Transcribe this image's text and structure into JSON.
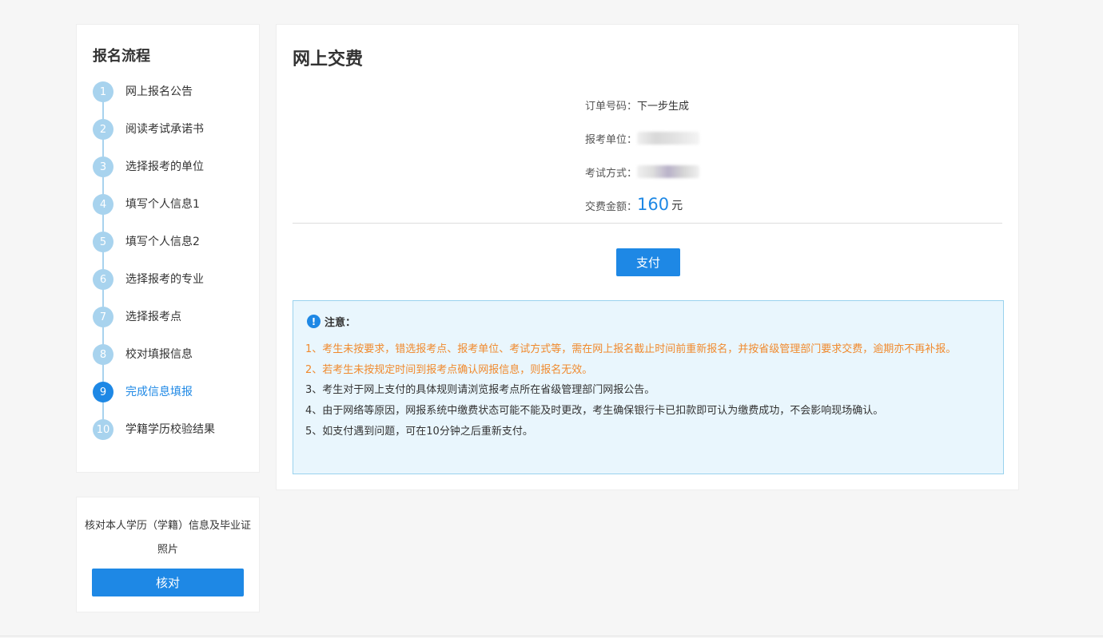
{
  "sidebar": {
    "title": "报名流程",
    "steps": [
      {
        "num": "1",
        "label": "网上报名公告"
      },
      {
        "num": "2",
        "label": "阅读考试承诺书"
      },
      {
        "num": "3",
        "label": "选择报考的单位"
      },
      {
        "num": "4",
        "label": "填写个人信息1"
      },
      {
        "num": "5",
        "label": "填写个人信息2"
      },
      {
        "num": "6",
        "label": "选择报考的专业"
      },
      {
        "num": "7",
        "label": "选择报考点"
      },
      {
        "num": "8",
        "label": "校对填报信息"
      },
      {
        "num": "9",
        "label": "完成信息填报"
      },
      {
        "num": "10",
        "label": "学籍学历校验结果"
      }
    ],
    "active_step": 9
  },
  "verify": {
    "text": "核对本人学历（学籍）信息及毕业证照片",
    "button": "核对"
  },
  "main": {
    "title": "网上交费",
    "order_label": "订单号码：",
    "order_value": "下一步生成",
    "unit_label": "报考单位：",
    "mode_label": "考试方式：",
    "amount_label": "交费金额：",
    "amount_value": "160",
    "amount_unit": "元",
    "pay_button": "支付",
    "notice_title": "注意：",
    "notice_items": [
      "1、考生未按要求，错选报考点、报考单位、考试方式等，需在网上报名截止时间前重新报名，并按省级管理部门要求交费，逾期亦不再补报。",
      "2、若考生未按规定时间到报考点确认网报信息，则报名无效。",
      "3、考生对于网上支付的具体规则请浏览报考点所在省级管理部门网报公告。",
      "4、由于网络等原因，网报系统中缴费状态可能不能及时更改，考生确保银行卡已扣款即可认为缴费成功，不会影响现场确认。",
      "5、如支付遇到问题，可在10分钟之后重新支付。"
    ]
  },
  "colors": {
    "accent": "#1e88e5",
    "step_inactive": "#a8d3ee",
    "warning_text": "#f08a2e",
    "notice_bg": "#e9f6fd"
  }
}
